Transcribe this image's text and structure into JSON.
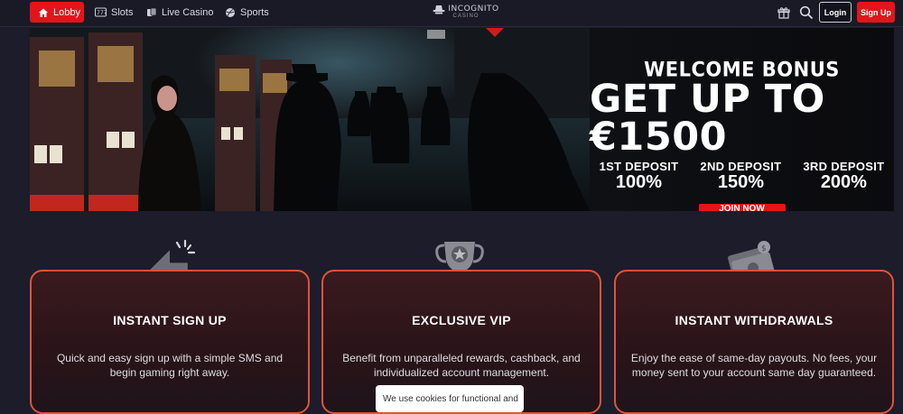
{
  "nav": {
    "lobby": "Lobby",
    "slots": "Slots",
    "live_casino": "Live Casino",
    "sports": "Sports",
    "logo_name": "INCOGNITO",
    "logo_sub": "CASINO",
    "login": "Login",
    "signup": "Sign Up"
  },
  "banner": {
    "welcome": "WELCOME BONUS",
    "amount": "GET UP TO €1500",
    "deposits": [
      {
        "label": "1ST DEPOSIT",
        "value": "100%"
      },
      {
        "label": "2ND DEPOSIT",
        "value": "150%"
      },
      {
        "label": "3RD DEPOSIT",
        "value": "200%"
      }
    ],
    "cta": "JOIN NOW"
  },
  "features": [
    {
      "title": "INSTANT SIGN UP",
      "desc": "Quick and easy sign up with a simple SMS and begin gaming right away.",
      "icon": "cursor-click-icon"
    },
    {
      "title": "EXCLUSIVE VIP",
      "desc": "Benefit from unparalleled rewards, cashback, and individualized account management.",
      "icon": "trophy-icon"
    },
    {
      "title": "INSTANT WITHDRAWALS",
      "desc": "Enjoy the ease of same-day payouts. No fees, your money sent to your account same day guaranteed.",
      "icon": "money-icon"
    }
  ],
  "cookie": {
    "text": "We use cookies for functional and"
  },
  "colors": {
    "accent": "#e4141b",
    "card_border": "#e0533b",
    "background": "#1c1c2b"
  }
}
